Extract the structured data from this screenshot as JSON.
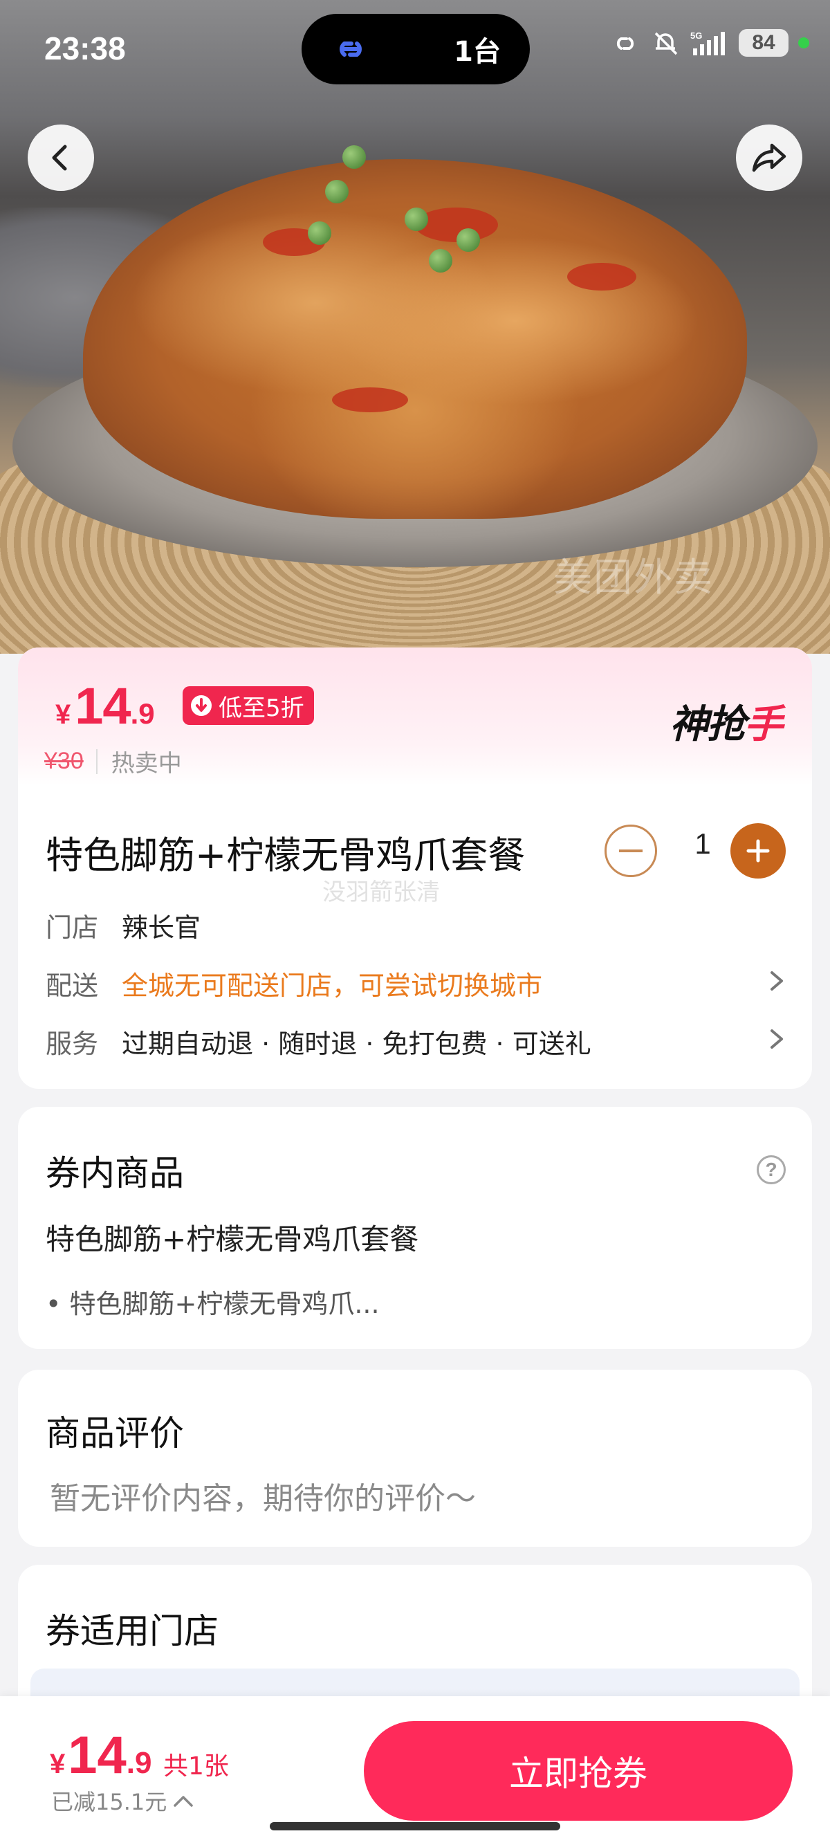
{
  "status_bar": {
    "time": "23:38",
    "island_count": "1台",
    "battery": "84",
    "icons": [
      "link-icon",
      "hotspot-icon",
      "mute-icon",
      "signal-5g-icon",
      "battery-icon"
    ]
  },
  "hero": {
    "watermark": "美团外卖"
  },
  "price": {
    "currency": "¥",
    "integer": "14",
    "decimal": ".9",
    "discount_tag": "低至5折",
    "original_price": "¥30",
    "status": "热卖中",
    "brand_logo_part1": "神抢",
    "brand_logo_part2": "手"
  },
  "product": {
    "title": "特色脚筋+柠檬无骨鸡爪套餐",
    "quantity": "1",
    "faint_watermark": "没羽箭张清"
  },
  "info": {
    "store_label": "门店",
    "store_value": "辣长官",
    "delivery_label": "配送",
    "delivery_value": "全城无可配送门店，可尝试切换城市",
    "service_label": "服务",
    "service_value": "过期自动退 · 随时退 · 免打包费 · 可送礼"
  },
  "coupon_items": {
    "title": "券内商品",
    "name": "特色脚筋+柠檬无骨鸡爪套餐",
    "item": "• 特色脚筋+柠檬无骨鸡爪..."
  },
  "reviews": {
    "title": "商品评价",
    "empty_text": "暂无评价内容，期待你的评价～"
  },
  "stores": {
    "title": "券适用门店"
  },
  "bottom_bar": {
    "currency": "¥",
    "integer": "14",
    "decimal": ".9",
    "count": "共1张",
    "reduced": "已减15.1元",
    "button": "立即抢券"
  },
  "colors": {
    "accent": "#f0264e",
    "button": "#ff2a5a",
    "orange": "#ea7a1d",
    "qty_plus": "#c7651c"
  }
}
